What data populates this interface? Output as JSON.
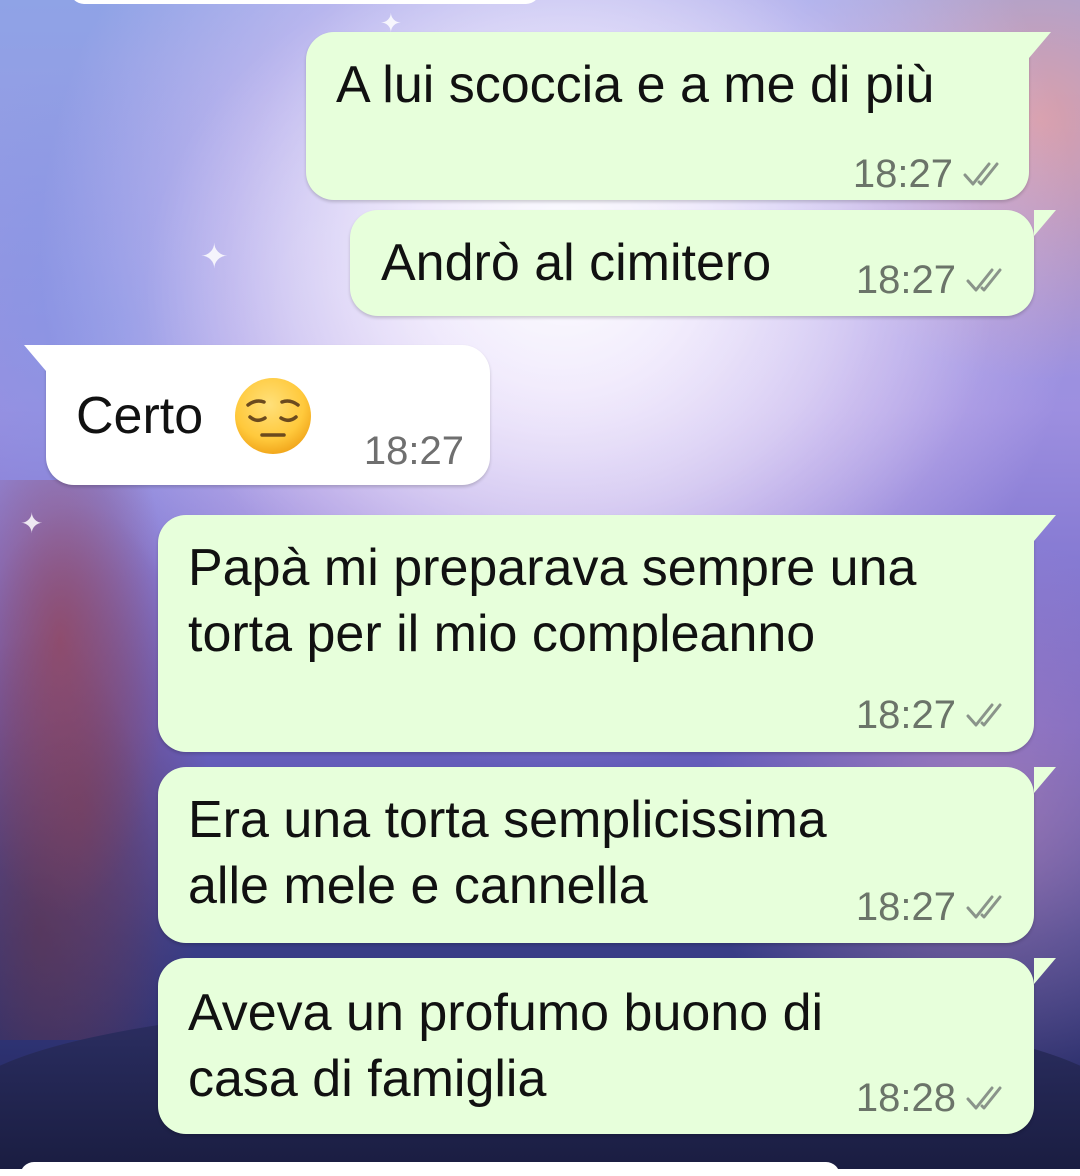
{
  "messages": [
    {
      "direction": "outgoing",
      "text": "A lui scoccia e a me di più",
      "time": "18:27",
      "status": "read"
    },
    {
      "direction": "outgoing",
      "text": "Andrò al cimitero",
      "time": "18:27",
      "status": "read"
    },
    {
      "direction": "incoming",
      "text": "Certo",
      "emoji": "pensive-face",
      "time": "18:27"
    },
    {
      "direction": "outgoing",
      "text": "Papà mi preparava sempre una\ntorta per il mio compleanno",
      "time": "18:27",
      "status": "read"
    },
    {
      "direction": "outgoing",
      "text": "Era una torta semplicissima\nalle mele e cannella",
      "time": "18:27",
      "status": "read"
    },
    {
      "direction": "outgoing",
      "text": "Aveva un profumo buono di\ncasa di famiglia",
      "time": "18:28",
      "status": "read"
    }
  ],
  "icons": {
    "read_receipt": "double-check-icon",
    "emoji": "pensive-face-emoji"
  },
  "colors": {
    "outgoing_bubble": "#e7ffdb",
    "incoming_bubble": "#ffffff",
    "text": "#111111",
    "timestamp": "#6b7469",
    "emoji_face": "#ffc93c"
  }
}
